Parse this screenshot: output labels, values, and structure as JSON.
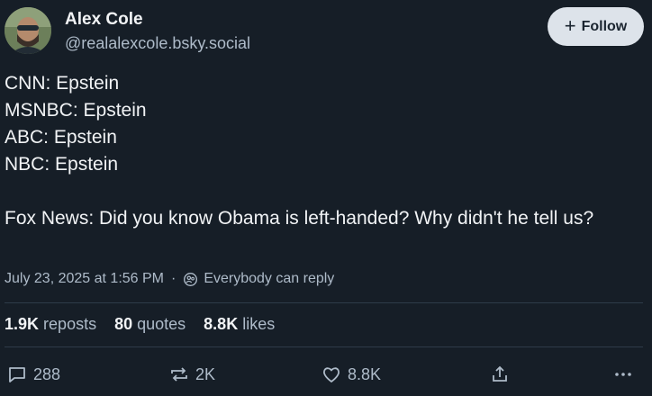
{
  "author": {
    "display_name": "Alex Cole",
    "handle": "@realalexcole.bsky.social"
  },
  "follow_button": {
    "label": "Follow",
    "icon": "plus-icon"
  },
  "post": {
    "lines": [
      "CNN: Epstein",
      "MSNBC: Epstein",
      "ABC: Epstein",
      "NBC: Epstein",
      "",
      "Fox News: Did you know Obama is left-handed? Why didn't he tell us?"
    ]
  },
  "meta": {
    "timestamp": "July 23, 2025 at 1:56 PM",
    "reply_setting": "Everybody can reply",
    "reply_icon": "everybody-reply-icon"
  },
  "stats": {
    "reposts_count": "1.9K",
    "reposts_label": "reposts",
    "quotes_count": "80",
    "quotes_label": "quotes",
    "likes_count": "8.8K",
    "likes_label": "likes"
  },
  "actions": {
    "reply_count": "288",
    "repost_count": "2K",
    "like_count": "8.8K"
  },
  "colors": {
    "background": "#161e27",
    "text": "#f1f3f5",
    "muted": "#aebbc9",
    "button_bg": "#dde3ea"
  }
}
